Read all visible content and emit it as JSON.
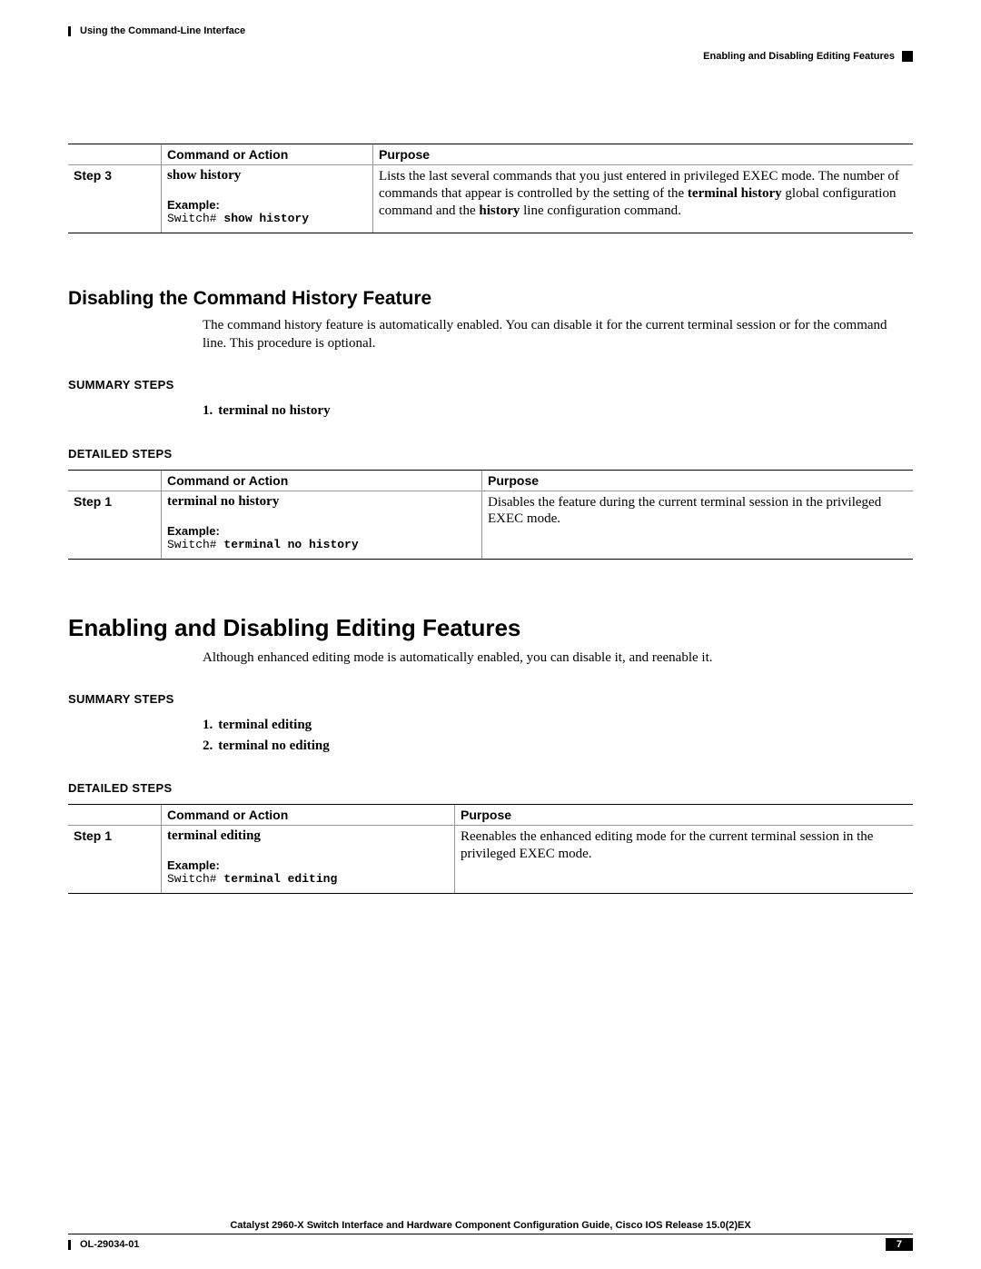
{
  "header": {
    "left": "Using the Command-Line Interface",
    "right": "Enabling and Disabling Editing Features"
  },
  "table1": {
    "columns": {
      "cmd": "Command or Action",
      "purpose": "Purpose"
    },
    "row": {
      "step": "Step 3",
      "command": "show history",
      "example_label": "Example:",
      "example_prompt": "Switch# ",
      "example_cmd": "show history",
      "purpose_pre": "Lists the last several commands that you just entered in privileged EXEC mode. The number of commands that appear is controlled by the setting of the ",
      "purpose_b1": "terminal history",
      "purpose_mid": " global configuration command and the ",
      "purpose_b2": "history",
      "purpose_post": " line configuration command."
    }
  },
  "section1": {
    "heading": "Disabling the Command History Feature",
    "body": "The command history feature is automatically enabled. You can disable it for the current terminal session or for the command line. This procedure is optional.",
    "summary_label": "SUMMARY STEPS",
    "summary": [
      {
        "n": "1.",
        "t": "terminal no history"
      }
    ],
    "detailed_label": "DETAILED STEPS",
    "table": {
      "columns": {
        "cmd": "Command or Action",
        "purpose": "Purpose"
      },
      "row": {
        "step": "Step 1",
        "command": "terminal no history",
        "example_label": "Example:",
        "example_prompt": "Switch# ",
        "example_cmd": "terminal no history",
        "purpose": "Disables the feature during the current terminal session in the privileged EXEC mode."
      }
    }
  },
  "section2": {
    "heading": "Enabling and Disabling Editing Features",
    "body": "Although enhanced editing mode is automatically enabled, you can disable it, and reenable it.",
    "summary_label": "SUMMARY STEPS",
    "summary": [
      {
        "n": "1.",
        "t": "terminal editing"
      },
      {
        "n": "2.",
        "t": "terminal no editing"
      }
    ],
    "detailed_label": "DETAILED STEPS",
    "table": {
      "columns": {
        "cmd": "Command or Action",
        "purpose": "Purpose"
      },
      "row": {
        "step": "Step 1",
        "command": "terminal editing",
        "example_label": "Example:",
        "example_prompt": "Switch# ",
        "example_cmd": "terminal editing",
        "purpose": "Reenables the enhanced editing mode for the current terminal session in the privileged EXEC mode."
      }
    }
  },
  "footer": {
    "title": "Catalyst 2960-X Switch Interface and Hardware Component Configuration Guide, Cisco IOS Release 15.0(2)EX",
    "doc": "OL-29034-01",
    "page": "7"
  }
}
